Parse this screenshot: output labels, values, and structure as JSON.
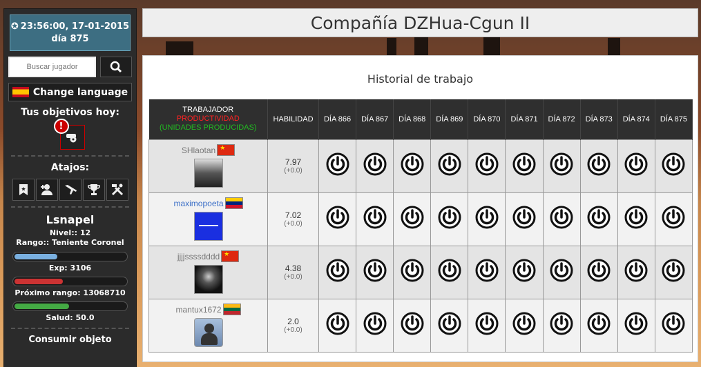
{
  "clock": {
    "time": "23:56:00, 17-01-2015",
    "day": "día 875"
  },
  "search": {
    "placeholder": "Buscar jugador"
  },
  "language": {
    "label": "Change language"
  },
  "objectives": {
    "title": "Tus objetivos hoy:",
    "badge": "!"
  },
  "shortcuts": {
    "title": "Atajos:",
    "icons": [
      "bookmark-icon",
      "user-add-icon",
      "plane-icon",
      "trophy-icon",
      "tools-icon"
    ]
  },
  "user": {
    "name": "Lsnapel",
    "level": "Nivel:: 12",
    "rank": "Rango:: Teniente Coronel",
    "exp_label": "Exp:  3106",
    "exp_fraction": 0.4,
    "next_rank_label": "Próximo rango:  13068710",
    "next_rank_fraction": 0.45,
    "health_label": "Salud:  50.0",
    "health_fraction": 0.5
  },
  "consume": {
    "title": "Consumir objeto"
  },
  "header": {
    "title": "Compañía DZHua-Cgun II"
  },
  "panel": {
    "title": "Historial de trabajo"
  },
  "table": {
    "col_worker": "TRABAJADOR",
    "col_productivity": "PRODUCTIVIDAD",
    "col_units": "(UNIDADES PRODUCIDAS)",
    "col_skill": "HABILIDAD",
    "days": [
      "DÍA 866",
      "DÍA 867",
      "DÍA 868",
      "DÍA 869",
      "DÍA 870",
      "DÍA 871",
      "DÍA 872",
      "DÍA 873",
      "DÍA 874",
      "DÍA 875"
    ],
    "rows": [
      {
        "name": "SHlaotan",
        "skill": "7.97",
        "delta": "(+0.0)"
      },
      {
        "name": "maximopoeta",
        "skill": "7.02",
        "delta": "(+0.0)"
      },
      {
        "name": "jjjjssssdddd",
        "skill": "4.38",
        "delta": "(+0.0)"
      },
      {
        "name": "mantux1672",
        "skill": "2.0",
        "delta": "(+0.0)"
      }
    ]
  },
  "colors": {
    "sidebar": "#2b2b2b",
    "clock": "#3d6e82",
    "exp_bar": "#7ab0e0",
    "rank_bar": "#cc3333",
    "health_bar": "#44aa44"
  }
}
